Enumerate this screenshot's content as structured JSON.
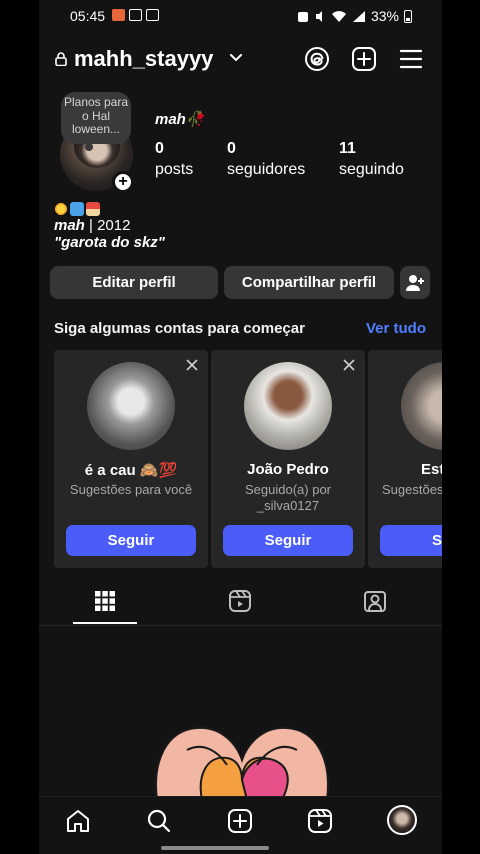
{
  "status_bar": {
    "time": "05:45",
    "battery": "33%"
  },
  "header": {
    "username": "mahh_stayyy",
    "icons": [
      "lock-icon",
      "chevron-down-icon",
      "threads-icon",
      "create-icon",
      "menu-icon"
    ]
  },
  "profile": {
    "note": "Planos para o Hal loween...",
    "name": "mah",
    "name_emoji": "🥀",
    "stats": [
      {
        "value": "0",
        "label": "posts"
      },
      {
        "value": "0",
        "label": "seguidores"
      },
      {
        "value": "11",
        "label": "seguindo"
      }
    ],
    "bio_line1_bold": "mah",
    "bio_line1_rest": " | 2012",
    "bio_line2": "\"garota do skz\""
  },
  "actions": {
    "edit_profile": "Editar perfil",
    "share_profile": "Compartilhar perfil"
  },
  "suggestions": {
    "title": "Siga algumas contas para começar",
    "see_all": "Ver tudo",
    "cards": [
      {
        "name": "é a cau 🙈💯",
        "subtitle": "Sugestões para você",
        "button": "Seguir"
      },
      {
        "name": "João Pedro",
        "subtitle": "Seguido(a) por _silva0127",
        "button": "Seguir"
      },
      {
        "name": "Est",
        "subtitle": "Sugestões",
        "button": "Seg"
      }
    ]
  },
  "colors": {
    "background": "#131313",
    "accent_link": "#4f7fff",
    "follow_button": "#4a5df9",
    "secondary_button": "#363636"
  }
}
